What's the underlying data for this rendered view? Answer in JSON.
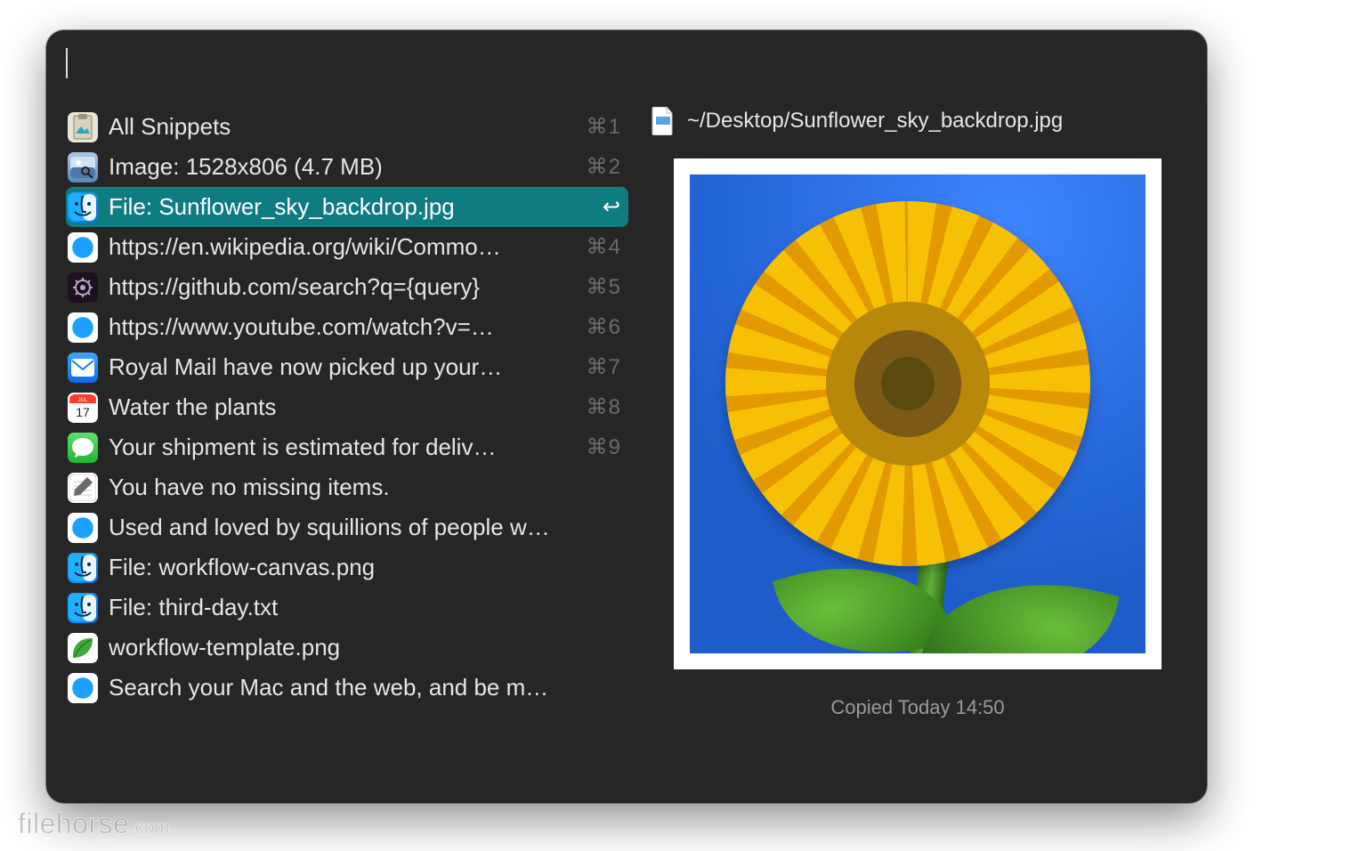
{
  "search": {
    "value": ""
  },
  "list": [
    {
      "icon": "clipboard",
      "label": "All Snippets",
      "shortcut": "⌘1"
    },
    {
      "icon": "preview",
      "label": "Image: 1528x806 (4.7 MB)",
      "shortcut": "⌘2"
    },
    {
      "icon": "finder",
      "label": "File: Sunflower_sky_backdrop.jpg",
      "shortcut": "↩",
      "selected": true
    },
    {
      "icon": "safari",
      "label": "https://en.wikipedia.org/wiki/Commo…",
      "shortcut": "⌘4"
    },
    {
      "icon": "cog",
      "label": "https://github.com/search?q={query}",
      "shortcut": "⌘5"
    },
    {
      "icon": "safari",
      "label": "https://www.youtube.com/watch?v=…",
      "shortcut": "⌘6"
    },
    {
      "icon": "mail",
      "label": "Royal Mail have now picked up your…",
      "shortcut": "⌘7"
    },
    {
      "icon": "calendar",
      "label": "Water the plants",
      "shortcut": "⌘8"
    },
    {
      "icon": "messages",
      "label": "Your shipment is estimated for deliv…",
      "shortcut": "⌘9"
    },
    {
      "icon": "text",
      "label": "You have no missing items.",
      "shortcut": ""
    },
    {
      "icon": "safari",
      "label": "Used and loved by squillions of people w…",
      "shortcut": ""
    },
    {
      "icon": "finder",
      "label": "File: workflow-canvas.png",
      "shortcut": ""
    },
    {
      "icon": "finder",
      "label": "File: third-day.txt",
      "shortcut": ""
    },
    {
      "icon": "leaf",
      "label": "workflow-template.png",
      "shortcut": ""
    },
    {
      "icon": "safari",
      "label": "Search your Mac and the web, and be m…",
      "shortcut": ""
    }
  ],
  "preview": {
    "path": "~/Desktop/Sunflower_sky_backdrop.jpg",
    "status": "Copied Today 14:50"
  },
  "watermark": "filehorse",
  "watermark_suffix": ".com"
}
